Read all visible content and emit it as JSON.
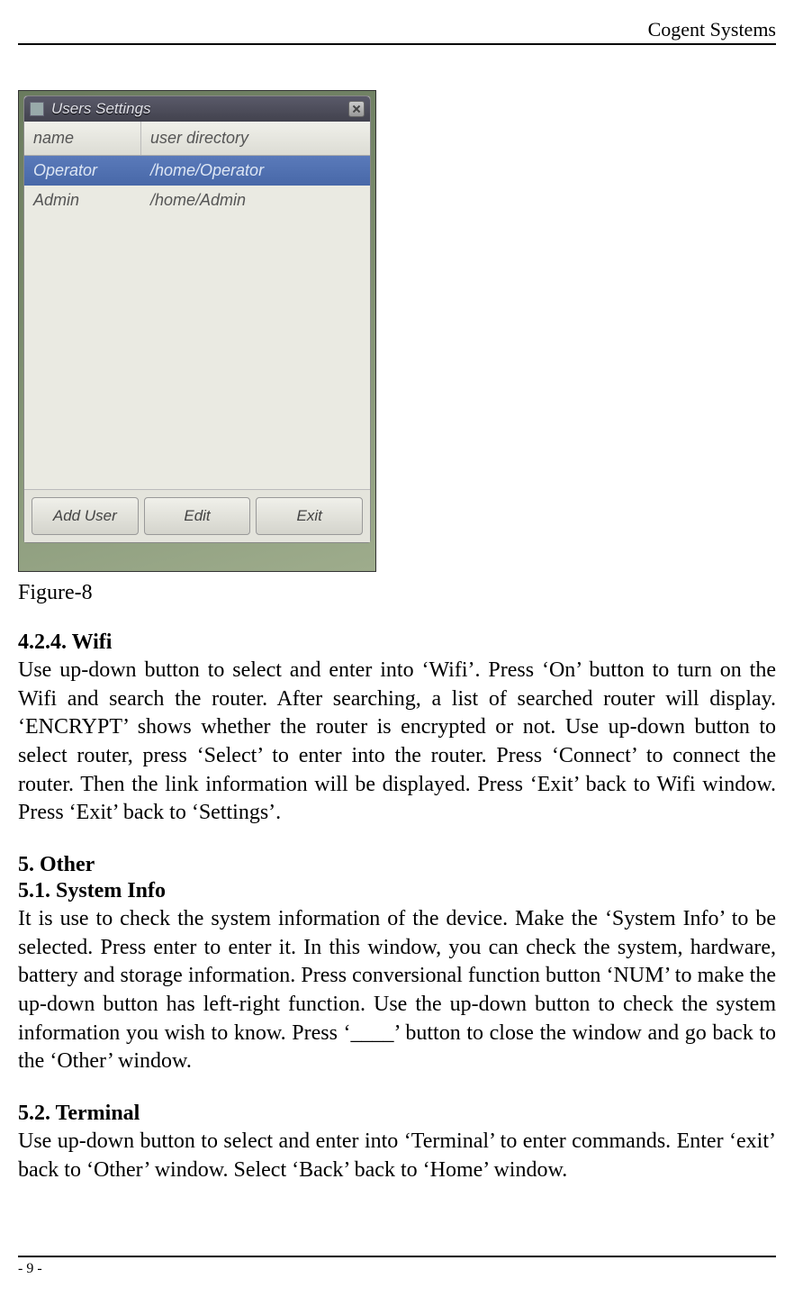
{
  "header": {
    "right": "Cogent Systems"
  },
  "screenshot": {
    "title": "Users Settings",
    "columns": {
      "name": "name",
      "dir": "user directory"
    },
    "rows": [
      {
        "name": "Operator",
        "dir": "/home/Operator"
      },
      {
        "name": "Admin",
        "dir": "/home/Admin"
      }
    ],
    "buttons": {
      "add": "Add User",
      "edit": "Edit",
      "exit": "Exit"
    }
  },
  "caption": "Figure-8",
  "sections": {
    "wifi": {
      "heading": "4.2.4. Wifi",
      "text": "Use up-down button to select and enter into ‘Wifi’. Press ‘On’ button to turn on the Wifi and search the router. After searching, a list of searched router will display. ‘ENCRYPT’ shows whether the router is encrypted or not. Use up-down button to select router, press ‘Select’ to enter into the router. Press ‘Connect’ to connect the router. Then the link information will be displayed. Press ‘Exit’ back to Wifi window. Press ‘Exit’ back to ‘Settings’."
    },
    "other": {
      "heading": "5. Other"
    },
    "sysinfo": {
      "heading": "5.1. System Info",
      "text": "It is use to check the system information of the device. Make the ‘System Info’ to be selected. Press enter to enter it. In this window, you can check the system, hardware, battery and storage information. Press conversional function button ‘NUM’ to make the up-down button has left-right function. Use the up-down button to check the system information you wish to know. Press ‘____’ button to close the window and go back to the ‘Other’ window."
    },
    "terminal": {
      "heading": "5.2. Terminal",
      "text": "Use up-down button to select and enter into ‘Terminal’ to enter commands. Enter ‘exit’ back to ‘Other’ window. Select ‘Back’ back to ‘Home’ window."
    }
  },
  "footer": {
    "page": "- 9 -"
  }
}
